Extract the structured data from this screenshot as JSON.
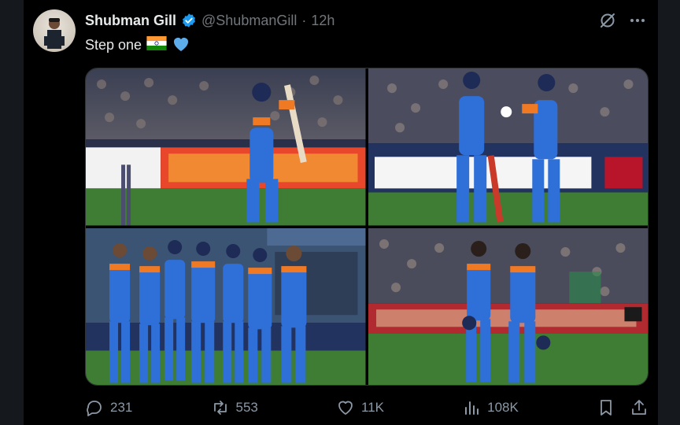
{
  "tweet": {
    "display_name": "Shubman Gill",
    "handle": "@ShubmanGill",
    "separator": "·",
    "time": "12h",
    "text": "Step one",
    "emojis": [
      "india-flag",
      "blue-heart"
    ],
    "accent_color": "#1d9bf0"
  },
  "media": {
    "photos": [
      {
        "description": "batsman-playing-shot"
      },
      {
        "description": "players-fist-bump"
      },
      {
        "description": "team-walking-off"
      },
      {
        "description": "two-batsmen-walking"
      }
    ]
  },
  "actions": {
    "replies": "231",
    "reposts": "553",
    "likes": "11K",
    "views": "108K"
  },
  "colors": {
    "background": "#000000",
    "text": "#e7e9ea",
    "muted": "#71767b",
    "jersey_blue": "#2f6fd8",
    "jersey_orange": "#f07a24",
    "pitch_green": "#4d8a3a"
  }
}
